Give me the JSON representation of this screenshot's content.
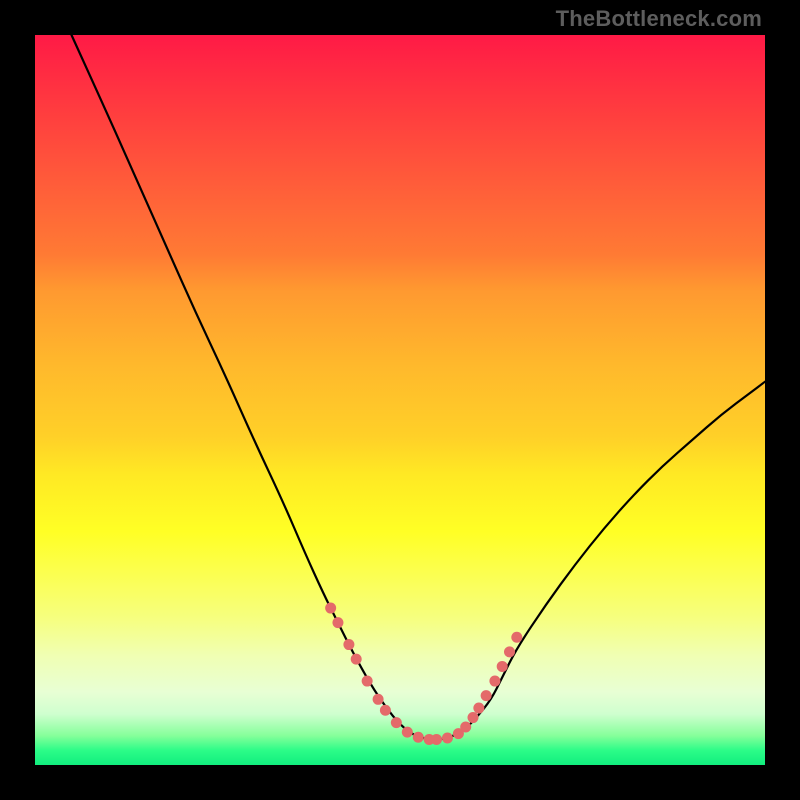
{
  "watermark": "TheBottleneck.com",
  "colors": {
    "frame": "#000000",
    "gradient_top": "#ff1a46",
    "gradient_bottom": "#11ee7e",
    "curve": "#000000",
    "beads": "#e46a6a"
  },
  "chart_data": {
    "type": "line",
    "title": "",
    "xlabel": "",
    "ylabel": "",
    "xlim": [
      0,
      100
    ],
    "ylim": [
      0,
      100
    ],
    "x": [
      5,
      10,
      14,
      18,
      22,
      26,
      30,
      34,
      37,
      39.5,
      41.5,
      43.5,
      46,
      48,
      50,
      52,
      54,
      56,
      58.5,
      60.5,
      62.5,
      64,
      66,
      70,
      74,
      78,
      82,
      86,
      90,
      94,
      98,
      100
    ],
    "values": [
      100,
      89,
      80,
      71,
      62,
      53.5,
      44.5,
      36,
      29,
      23.5,
      19.5,
      15.5,
      11,
      8,
      5.5,
      4,
      3.5,
      3.5,
      4.5,
      6.5,
      9,
      12,
      16,
      22,
      27.5,
      32.5,
      37,
      41,
      44.5,
      48,
      51,
      52.5
    ],
    "beads_x": [
      40.5,
      41.5,
      43,
      44,
      45.5,
      47,
      48,
      49.5,
      51,
      52.5,
      54,
      55,
      56.5,
      58,
      59,
      60,
      60.8,
      61.8,
      63,
      64,
      65,
      66
    ],
    "beads_y": [
      21.5,
      19.5,
      16.5,
      14.5,
      11.5,
      9,
      7.5,
      5.8,
      4.5,
      3.8,
      3.5,
      3.5,
      3.7,
      4.3,
      5.2,
      6.5,
      7.8,
      9.5,
      11.5,
      13.5,
      15.5,
      17.5
    ]
  }
}
